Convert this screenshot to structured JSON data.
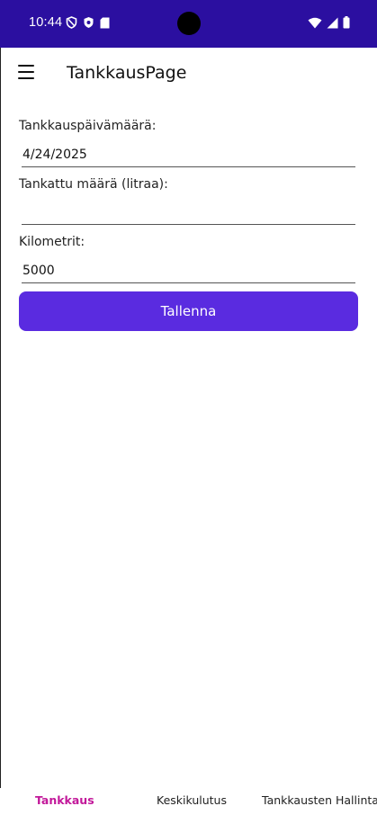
{
  "status_bar": {
    "time": "10:44",
    "left_icons": [
      "no-disturb-icon",
      "shield-icon",
      "sd-card-icon"
    ],
    "right_icons": [
      "wifi-icon",
      "signal-icon",
      "battery-icon"
    ],
    "background": "#2b0fa0"
  },
  "app_bar": {
    "title": "TankkausPage"
  },
  "form": {
    "date_label": "Tankkauspäivämäärä:",
    "date_value": "4/24/2025",
    "amount_label": "Tankattu määrä (litraa):",
    "amount_value": "",
    "km_label": "Kilometrit:",
    "km_value": "5000",
    "save_label": "Tallenna"
  },
  "bottom_nav": {
    "tabs": [
      {
        "label": "Tankkaus",
        "active": true
      },
      {
        "label": "Keskikulutus",
        "active": false
      },
      {
        "label": "Tankkausten Hallinta",
        "active": false
      }
    ]
  },
  "colors": {
    "primary": "#5a2be0",
    "accent": "#c2189a"
  }
}
